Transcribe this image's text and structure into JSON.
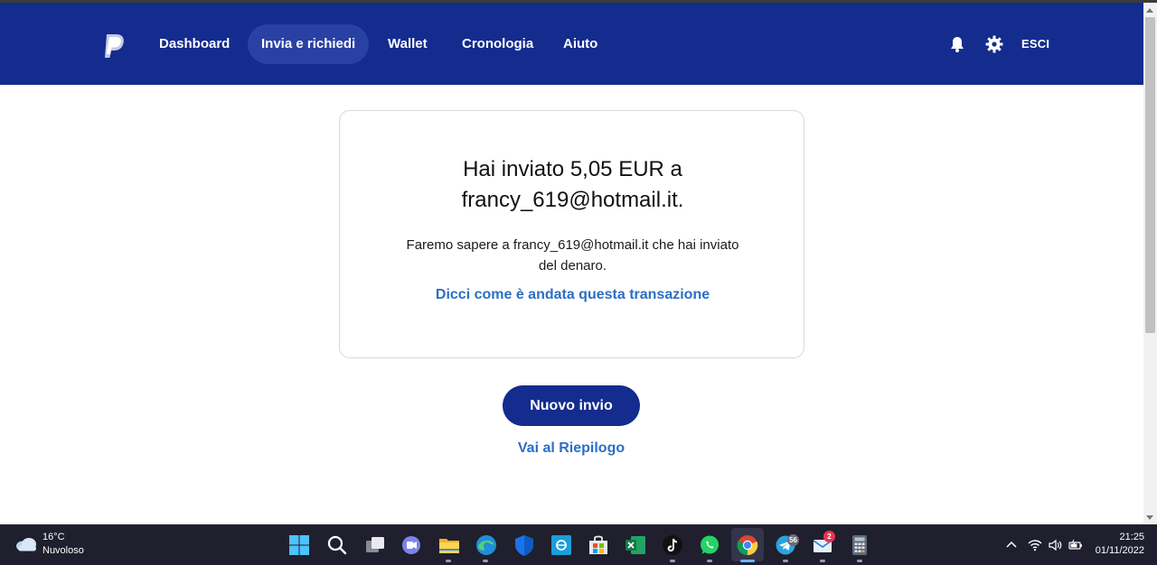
{
  "nav": {
    "items": [
      {
        "label": "Dashboard",
        "active": false
      },
      {
        "label": "Invia e richiedi",
        "active": true
      },
      {
        "label": "Wallet",
        "active": false
      },
      {
        "label": "Cronologia",
        "active": false
      },
      {
        "label": "Aiuto",
        "active": false
      }
    ],
    "logout_label": "ESCI",
    "icons": [
      "paypal-logo",
      "bell-icon",
      "gear-icon"
    ]
  },
  "confirmation": {
    "headline_line1": "Hai inviato 5,05 EUR a",
    "headline_line2": "francy_619@hotmail.it.",
    "message_line1": "Faremo sapere a francy_619@hotmail.it che hai inviato",
    "message_line2": "del denaro.",
    "feedback_link": "Dicci come è andata questa transazione"
  },
  "actions": {
    "new_send_label": "Nuovo invio",
    "summary_link": "Vai al Riepilogo"
  },
  "taskbar": {
    "weather": {
      "temp": "16°C",
      "desc": "Nuvoloso"
    },
    "apps": [
      "windows-start",
      "search",
      "task-view",
      "teams-chat",
      "file-explorer",
      "edge",
      "defender",
      "store-app",
      "ms-store",
      "excel",
      "tiktok",
      "whatsapp",
      "chrome",
      "telegram",
      "mail",
      "calculator"
    ],
    "telegram_badge": "56",
    "mail_badge": "2",
    "clock": {
      "time": "21:25",
      "date": "01/11/2022"
    }
  },
  "colors": {
    "brand_navy": "#142c8e",
    "link_blue": "#2b6fc4",
    "taskbar": "#1f1f2e"
  }
}
